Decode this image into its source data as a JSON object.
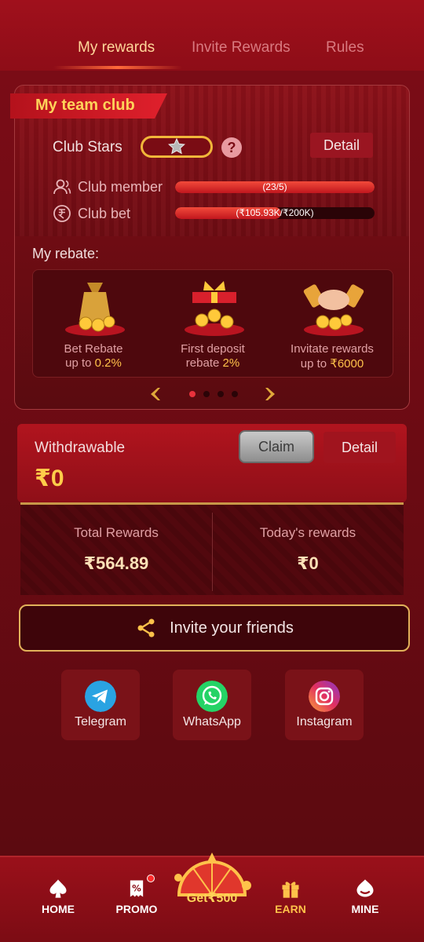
{
  "tabs": {
    "items": [
      {
        "label": "My rewards",
        "active": true
      },
      {
        "label": "Invite Rewards",
        "active": false
      },
      {
        "label": "Rules",
        "active": false
      }
    ]
  },
  "club": {
    "title": "My team club",
    "stars_label": "Club Stars",
    "detail_label": "Detail",
    "member": {
      "label": "Club member",
      "progress_text": "(23/5)",
      "fraction": 1.0
    },
    "bet": {
      "label": "Club bet",
      "progress_text": "(₹105.93K/₹200K)",
      "fraction": 0.53
    }
  },
  "rebate": {
    "title": "My rebate:",
    "items": [
      {
        "line1": "Bet Rebate",
        "line2_prefix": "up to ",
        "line2_value": "0.2%"
      },
      {
        "line1": "First deposit",
        "line2_prefix": "rebate ",
        "line2_value": "2%"
      },
      {
        "line1": "Invitate rewards",
        "line2_prefix": "up to ",
        "line2_value": "₹6000"
      }
    ],
    "pager": {
      "total": 4,
      "active_index": 0
    }
  },
  "withdraw": {
    "label": "Withdrawable",
    "amount": "₹0",
    "claim_label": "Claim",
    "detail_label": "Detail"
  },
  "rewards": {
    "total_label": "Total Rewards",
    "total_value": "₹564.89",
    "today_label": "Today's rewards",
    "today_value": "₹0"
  },
  "invite": {
    "label": "Invite your friends"
  },
  "social": [
    {
      "label": "Telegram",
      "icon": "telegram-icon",
      "color": "#2aa3e2"
    },
    {
      "label": "WhatsApp",
      "icon": "whatsapp-icon",
      "color": "#25d366"
    },
    {
      "label": "Instagram",
      "icon": "instagram-icon",
      "color": "#d6306f"
    }
  ],
  "nav": {
    "home": "HOME",
    "promo": "PROMO",
    "wheel": "Get₹500",
    "earn": "EARN",
    "mine": "MINE"
  },
  "colors": {
    "accent_gold": "#ffc24a",
    "brand_red": "#a0101c"
  }
}
